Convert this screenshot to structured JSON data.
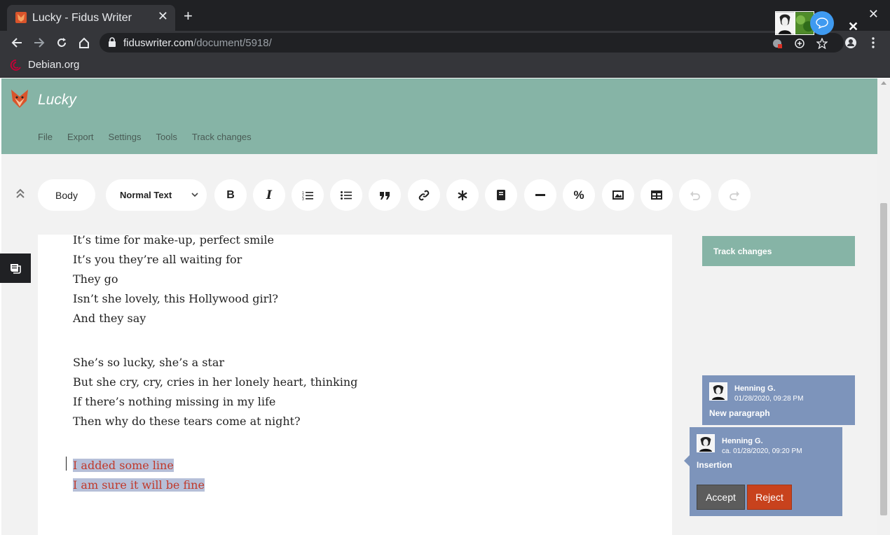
{
  "browser": {
    "tab_title": "Lucky - Fidus Writer",
    "url_host": "fiduswriter.com",
    "url_path": "/document/5918/",
    "bookmark_label": "Debian.org"
  },
  "app": {
    "doc_title": "Lucky",
    "menu": [
      "File",
      "Export",
      "Settings",
      "Tools",
      "Track changes"
    ]
  },
  "toolbar": {
    "block_style": "Body",
    "text_style": "Normal Text",
    "buttons": [
      "bold",
      "italic",
      "numbered-list",
      "bullet-list",
      "quote",
      "link",
      "footnote",
      "citation",
      "horizontal-rule",
      "math",
      "figure",
      "table",
      "undo",
      "redo"
    ]
  },
  "document": {
    "lines": [
      "It’s time for make-up, perfect smile",
      "It’s you they’re all waiting for",
      "They go",
      "Isn’t she lovely, this Hollywood girl?",
      "And they say",
      "She’s so lucky, she’s a star",
      "But she cry, cry, cries in her lonely heart, thinking",
      "If there’s nothing missing in my life",
      "Then why do these tears come at night?"
    ],
    "inserted_lines": [
      "I added some line",
      "I am sure it will be fine"
    ]
  },
  "track_changes": {
    "header": "Track changes",
    "changes": [
      {
        "user": "Henning G.",
        "date": "01/28/2020, 09:28 PM",
        "type": "New paragraph"
      },
      {
        "user": "Henning G.",
        "date": "ca. 01/28/2020, 09:20 PM",
        "type": "Insertion",
        "accept_label": "Accept",
        "reject_label": "Reject"
      }
    ]
  },
  "colors": {
    "header_green": "#86b4a6",
    "card_blue": "#7d94bb",
    "inserted_text": "#c0392b",
    "reject_red": "#c8421d"
  }
}
